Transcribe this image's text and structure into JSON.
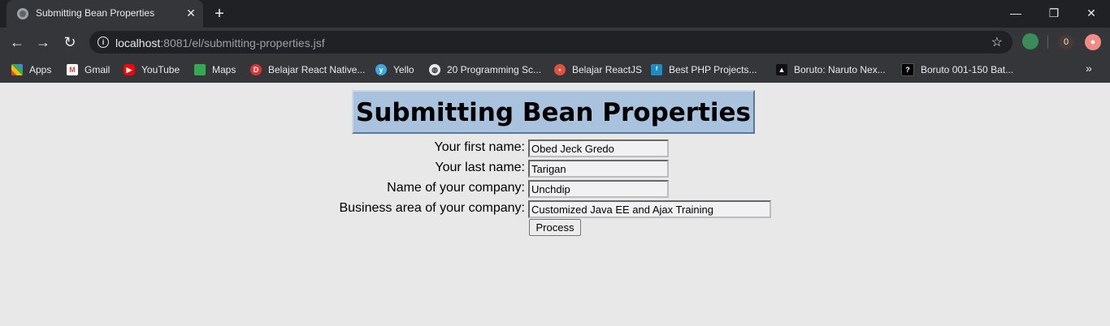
{
  "tab": {
    "title": "Submitting Bean Properties",
    "close": "✕",
    "new_tab": "+"
  },
  "window_controls": {
    "minimize": "—",
    "restore": "❐",
    "close": "✕"
  },
  "nav": {
    "back": "←",
    "forward": "→",
    "reload": "↻"
  },
  "address": {
    "host": "localhost",
    "rest": ":8081/el/submitting-properties.jsf"
  },
  "extensions": {
    "badge": "0"
  },
  "bookmarks": [
    {
      "label": "Apps",
      "icon": "apps-grid-icon"
    },
    {
      "label": "Gmail",
      "icon": "gmail-icon"
    },
    {
      "label": "YouTube",
      "icon": "youtube-icon"
    },
    {
      "label": "Maps",
      "icon": "maps-icon"
    },
    {
      "label": "Belajar React Native...",
      "icon": "dw-icon"
    },
    {
      "label": "Yello",
      "icon": "yello-icon"
    },
    {
      "label": "20 Programming Sc...",
      "icon": "globe-icon"
    },
    {
      "label": "Belajar ReactJS",
      "icon": "reactjs-icon"
    },
    {
      "label": "Best PHP Projects...",
      "icon": "php-icon"
    },
    {
      "label": "Boruto: Naruto Nex...",
      "icon": "cat-icon"
    },
    {
      "label": "Boruto 001-150 Bat...",
      "icon": "boruto-icon"
    }
  ],
  "bookmarks_more": "»",
  "page": {
    "heading": "Submitting Bean Properties",
    "fields": [
      {
        "label": "Your first name:",
        "value": "Obed Jeck Gredo"
      },
      {
        "label": "Your last name:",
        "value": "Tarigan"
      },
      {
        "label": "Name of your company:",
        "value": "Unchdip"
      },
      {
        "label": "Business area of your company:",
        "value": "Customized Java EE and Ajax Training"
      }
    ],
    "submit_label": "Process"
  }
}
